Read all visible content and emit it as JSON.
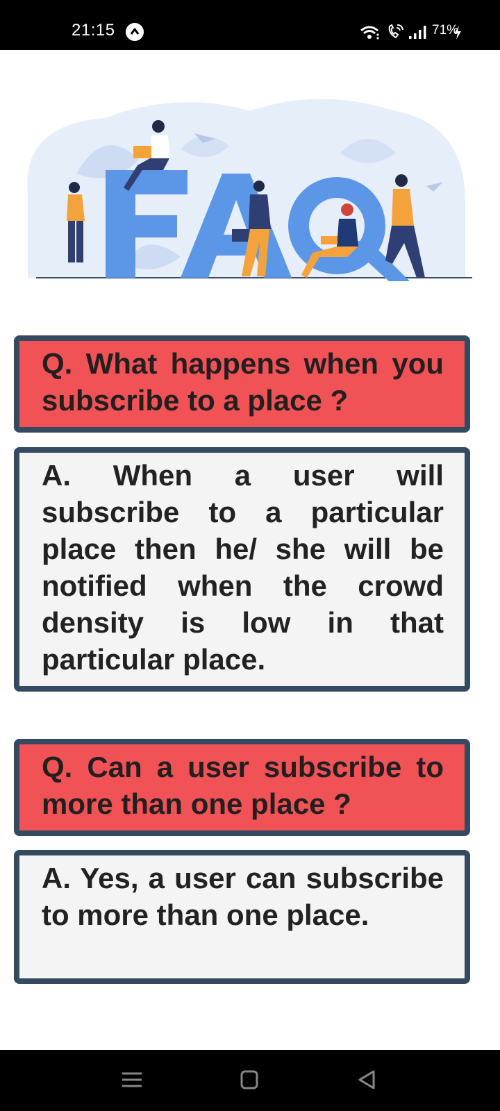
{
  "status_bar": {
    "time": "21:15",
    "battery": "71%",
    "app_icon": "caret-up-circle-icon",
    "icons": [
      "wifi-icon",
      "wifi-call-icon",
      "signal-icon",
      "charging-icon"
    ]
  },
  "hero": {
    "image": "faq-illustration",
    "letters": "FAQ"
  },
  "faqs": [
    {
      "question": "Q. What happens when you subscribe to a place ?",
      "answer": "A. When a user will subscribe to a particular place then he/ she will be notified when the crowd density is low in that particular place."
    },
    {
      "question": "Q. Can a user subscribe to more than one place ?",
      "answer": "A. Yes, a user can subscribe to more than one place."
    }
  ],
  "nav_bar": {
    "buttons": [
      "recents-icon",
      "home-icon",
      "back-icon"
    ]
  },
  "colors": {
    "question_bg": "#f15255",
    "answer_bg": "#f4f4f4",
    "card_border": "#334a61",
    "illustration_blue": "#5b97e6"
  }
}
